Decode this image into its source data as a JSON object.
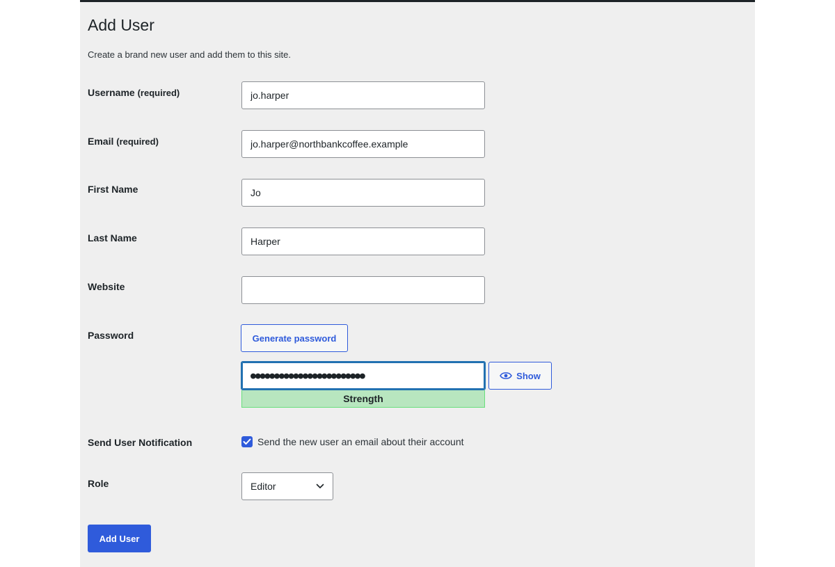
{
  "page": {
    "title": "Add User",
    "subtitle": "Create a brand new user and add them to this site."
  },
  "fields": {
    "username": {
      "label": "Username",
      "required_note": "(required)",
      "value": "jo.harper"
    },
    "email": {
      "label": "Email",
      "required_note": "(required)",
      "value": "jo.harper@northbankcoffee.example"
    },
    "first_name": {
      "label": "First Name",
      "value": "Jo"
    },
    "last_name": {
      "label": "Last Name",
      "value": "Harper"
    },
    "website": {
      "label": "Website",
      "value": ""
    }
  },
  "password": {
    "label": "Password",
    "generate_label": "Generate password",
    "value": "●●●●●●●●●●●●●●●●●●●●●●●●",
    "show_label": "Show",
    "show_icon": "eye-icon",
    "strength": "Strength"
  },
  "notification": {
    "label": "Send User Notification",
    "checked": true,
    "checkbox_label": "Send the new user an email about their account"
  },
  "role": {
    "label": "Role",
    "selected": "Editor"
  },
  "submit": {
    "label": "Add User"
  },
  "colors": {
    "accent": "#2f5bdb",
    "panel_bg": "#efefef",
    "strength_bg": "#b8e6bf",
    "focus_border": "#2271b1"
  }
}
